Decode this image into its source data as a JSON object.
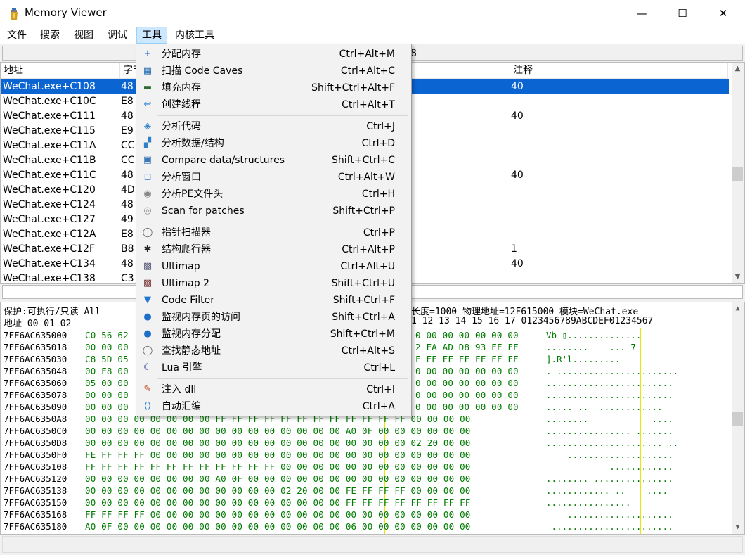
{
  "window": {
    "title": "Memory Viewer",
    "min_glyph": "—",
    "max_glyph": "☐",
    "close_glyph": "✕"
  },
  "menubar": [
    {
      "label": "文件"
    },
    {
      "label": "搜索"
    },
    {
      "label": "视图"
    },
    {
      "label": "调试"
    },
    {
      "label": "工具",
      "active": true
    },
    {
      "label": "内核工具"
    }
  ],
  "address_bar": {
    "visible_text": "8"
  },
  "disasm": {
    "columns": [
      "地址",
      "字节",
      "注释"
    ],
    "rows": [
      {
        "addr": "WeChat.exe+C108",
        "bytes": "48",
        "comment": "40",
        "selected": true
      },
      {
        "addr": "WeChat.exe+C10C",
        "bytes": "E8",
        "comment": ""
      },
      {
        "addr": "WeChat.exe+C111",
        "bytes": "48",
        "comment": "40"
      },
      {
        "addr": "WeChat.exe+C115",
        "bytes": "E9",
        "comment": ""
      },
      {
        "addr": "WeChat.exe+C11A",
        "bytes": "CC",
        "comment": ""
      },
      {
        "addr": "WeChat.exe+C11B",
        "bytes": "CC",
        "comment": ""
      },
      {
        "addr": "WeChat.exe+C11C",
        "bytes": "48",
        "comment": "40"
      },
      {
        "addr": "WeChat.exe+C120",
        "bytes": "4D",
        "comment": ""
      },
      {
        "addr": "WeChat.exe+C124",
        "bytes": "48",
        "comment": ""
      },
      {
        "addr": "WeChat.exe+C127",
        "bytes": "49",
        "comment": ""
      },
      {
        "addr": "WeChat.exe+C12A",
        "bytes": "E8",
        "comment": ""
      },
      {
        "addr": "WeChat.exe+C12F",
        "bytes": "B8",
        "comment": "1"
      },
      {
        "addr": "WeChat.exe+C134",
        "bytes": "48",
        "comment": "40"
      },
      {
        "addr": "WeChat.exe+C138",
        "bytes": "C3",
        "comment": ""
      }
    ]
  },
  "hex": {
    "info_left": "保护:可执行/只读  All",
    "info_right": "长度=1000 物理地址=12F615000 模块=WeChat.exe",
    "header_left": "地址     00 01 02",
    "header_right": "1 12 13 14 15 16 17  0123456789ABCDEF01234567",
    "rows": [
      {
        "addr": "7FF6AC635000",
        "bytes": "C0 56 62",
        "tail": "0 00 00 00 00 00 00",
        "ascii": "Vb ▯.............."
      },
      {
        "addr": "7FF6AC635018",
        "bytes": "00 00 00",
        "tail": "2 FA AD D8 93 FF FF",
        "ascii": "........    ... 7"
      },
      {
        "addr": "7FF6AC635030",
        "bytes": "C8 5D 05",
        "tail": "F FF FF FF FF FF FF",
        "ascii": "].R'l........."
      },
      {
        "addr": "7FF6AC635048",
        "bytes": "00 F8 00",
        "tail": "0 00 00 00 00 00 00",
        "ascii": ". ......................."
      },
      {
        "addr": "7FF6AC635060",
        "bytes": "05 00 00",
        "tail": "0 00 00 00 00 00 00",
        "ascii": "........................"
      },
      {
        "addr": "7FF6AC635078",
        "bytes": "00 00 00",
        "tail": "0 00 00 00 00 00 00",
        "ascii": "........................"
      },
      {
        "addr": "7FF6AC635090",
        "bytes": "00 00 00",
        "tail": "0 00 00 00 00 00 00",
        "ascii": "..... ..  ............"
      },
      {
        "addr": "7FF6AC6350A8",
        "bytes": "00 00 00 00 00 00 00 00 FF FF FF FF FF FF FF FF FF FF FF FF 00 00 00 00",
        "tail": "",
        "ascii": "........            ...."
      },
      {
        "addr": "7FF6AC6350C0",
        "bytes": "00 00 00 00 00 00 00 00 00 00 00 00 00 00 00 00 A0 0F 00 00 00 00 00 00",
        "tail": "",
        "ascii": "................ ......."
      },
      {
        "addr": "7FF6AC6350D8",
        "bytes": "00 00 00 00 00 00 00 00 00 00 00 00 00 00 00 00 00 00 00 00 02 20 00 00",
        "tail": "",
        "ascii": "...................... .."
      },
      {
        "addr": "7FF6AC6350F0",
        "bytes": "FE FF FF FF 00 00 00 00 00 00 00 00 00 00 00 00 00 00 00 00 00 00 00 00",
        "tail": "",
        "ascii": "    ...................."
      },
      {
        "addr": "7FF6AC635108",
        "bytes": "FF FF FF FF FF FF FF FF FF FF FF FF 00 00 00 00 00 00 00 00 00 00 00 00",
        "tail": "",
        "ascii": "            ............"
      },
      {
        "addr": "7FF6AC635120",
        "bytes": "00 00 00 00 00 00 00 00 A0 0F 00 00 00 00 00 00 00 00 00 00 00 00 00 00",
        "tail": "",
        "ascii": "........ ..............."
      },
      {
        "addr": "7FF6AC635138",
        "bytes": "00 00 00 00 00 00 00 00 00 00 00 00 02 20 00 00 FE FF FF FF 00 00 00 00",
        "tail": "",
        "ascii": "............ ..    ...."
      },
      {
        "addr": "7FF6AC635150",
        "bytes": "00 00 00 00 00 00 00 00 00 00 00 00 00 00 00 00 FF FF FF FF FF FF FF FF",
        "tail": "",
        "ascii": "................        "
      },
      {
        "addr": "7FF6AC635168",
        "bytes": "FF FF FF FF 00 00 00 00 00 00 00 00 00 00 00 00 00 00 00 00 00 00 00 00",
        "tail": "",
        "ascii": "    ...................."
      },
      {
        "addr": "7FF6AC635180",
        "bytes": "A0 0F 00 00 00 00 00 00 00 00 00 00 00 00 00 00 06 00 00 00 00 00 00 00",
        "tail": "",
        "ascii": " ......................."
      }
    ]
  },
  "dropdown": {
    "items": [
      {
        "icon": "allocate-memory-icon",
        "glyph": "+",
        "color": "#1e6fc8",
        "label": "分配内存",
        "shortcut": "Ctrl+Alt+M"
      },
      {
        "icon": "code-caves-icon",
        "glyph": "▦",
        "color": "#2a6fb0",
        "label": "扫描 Code Caves",
        "shortcut": "Ctrl+Alt+C"
      },
      {
        "icon": "fill-memory-icon",
        "glyph": "▬",
        "color": "#2f6b2f",
        "label": "填充内存",
        "shortcut": "Shift+Ctrl+Alt+F"
      },
      {
        "icon": "create-thread-icon",
        "glyph": "↩",
        "color": "#1e78d0",
        "label": "创建线程",
        "shortcut": "Ctrl+Alt+T",
        "sep_after": true
      },
      {
        "icon": "dissect-code-icon",
        "glyph": "◈",
        "color": "#2f7ec8",
        "label": "分析代码",
        "shortcut": "Ctrl+J"
      },
      {
        "icon": "dissect-data-icon",
        "glyph": "▞",
        "color": "#2f7ec8",
        "label": "分析数据/结构",
        "shortcut": "Ctrl+D"
      },
      {
        "icon": "compare-data-icon",
        "glyph": "▣",
        "color": "#3a78b8",
        "label": "Compare data/structures",
        "shortcut": "Shift+Ctrl+C"
      },
      {
        "icon": "dissect-window-icon",
        "glyph": "◻",
        "color": "#2f7ec8",
        "label": "分析窗口",
        "shortcut": "Ctrl+Alt+W"
      },
      {
        "icon": "dissect-pe-icon",
        "glyph": "◉",
        "color": "#888888",
        "label": "分析PE文件头",
        "shortcut": "Ctrl+H"
      },
      {
        "icon": "scan-patches-icon",
        "glyph": "◎",
        "color": "#888888",
        "label": "Scan for patches",
        "shortcut": "Shift+Ctrl+P",
        "sep_after": true
      },
      {
        "icon": "pointer-scanner-icon",
        "glyph": "◯",
        "color": "#666666",
        "label": "指针扫描器",
        "shortcut": "Ctrl+P"
      },
      {
        "icon": "structure-spider-icon",
        "glyph": "✱",
        "color": "#222222",
        "label": "结构爬行器",
        "shortcut": "Ctrl+Alt+P"
      },
      {
        "icon": "ultimap-icon",
        "glyph": "▩",
        "color": "#5a5a7a",
        "label": "Ultimap",
        "shortcut": "Ctrl+Alt+U"
      },
      {
        "icon": "ultimap2-icon",
        "glyph": "▩",
        "color": "#7a3a3a",
        "label": "Ultimap 2",
        "shortcut": "Shift+Ctrl+U"
      },
      {
        "icon": "code-filter-icon",
        "glyph": "▼",
        "color": "#1e78d0",
        "label": "Code Filter",
        "shortcut": "Shift+Ctrl+F"
      },
      {
        "icon": "watch-page-access-icon",
        "glyph": "●",
        "color": "#1e6fc8",
        "label": "监视内存页的访问",
        "shortcut": "Shift+Ctrl+A"
      },
      {
        "icon": "watch-allocations-icon",
        "glyph": "●",
        "color": "#1e6fc8",
        "label": "监视内存分配",
        "shortcut": "Shift+Ctrl+M"
      },
      {
        "icon": "find-static-icon",
        "glyph": "◯",
        "color": "#666666",
        "label": "查找静态地址",
        "shortcut": "Ctrl+Alt+S"
      },
      {
        "icon": "lua-engine-icon",
        "glyph": "☾",
        "color": "#1a2a8a",
        "label": "Lua 引擎",
        "shortcut": "Ctrl+L",
        "sep_after": true
      },
      {
        "icon": "inject-dll-icon",
        "glyph": "✎",
        "color": "#c05020",
        "label": "注入 dll",
        "shortcut": "Ctrl+I"
      },
      {
        "icon": "auto-assemble-icon",
        "glyph": "⟨⟩",
        "color": "#2f7ec8",
        "label": "自动汇编",
        "shortcut": "Ctrl+A"
      }
    ]
  }
}
